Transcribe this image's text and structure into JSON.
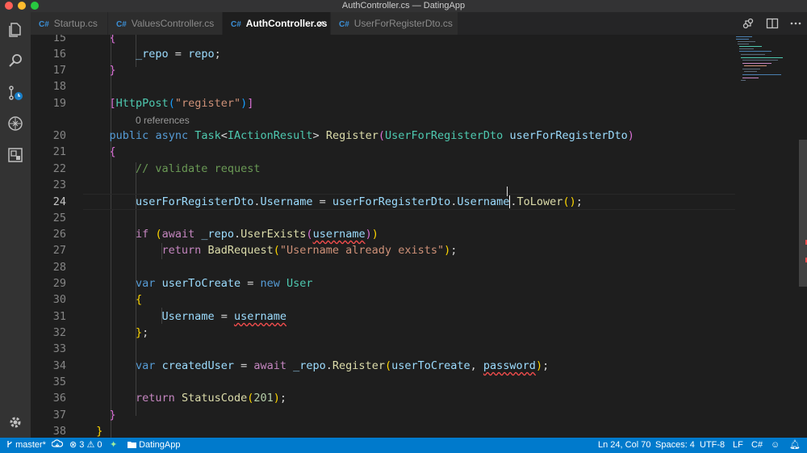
{
  "window": {
    "title": "AuthController.cs — DatingApp"
  },
  "tabs": [
    {
      "icon": "C#",
      "label": "Startup.cs"
    },
    {
      "icon": "C#",
      "label": "ValuesController.cs"
    },
    {
      "icon": "C#",
      "label": "AuthController.cs",
      "close": "×"
    },
    {
      "icon": "C#",
      "label": "UserForRegisterDto.cs"
    }
  ],
  "editor": {
    "line_numbers": [
      "15",
      "16",
      "17",
      "18",
      "19",
      "20",
      "21",
      "22",
      "23",
      "24",
      "25",
      "26",
      "27",
      "28",
      "29",
      "30",
      "31",
      "32",
      "33",
      "34",
      "35",
      "36",
      "37",
      "38"
    ],
    "codelens": "0 references"
  },
  "statusbar": {
    "branch": "master*",
    "errors": "3",
    "warnings": "0",
    "folder": "DatingApp",
    "position": "Ln 24, Col 70",
    "spaces": "Spaces: 4",
    "encoding": "UTF-8",
    "eol": "LF",
    "language": "C#"
  },
  "colors": {
    "accent": "#007acc",
    "editor_bg": "#1e1e1e",
    "keyword": "#569cd6",
    "type": "#4ec9b0",
    "string": "#ce9178",
    "comment": "#6a9955"
  }
}
